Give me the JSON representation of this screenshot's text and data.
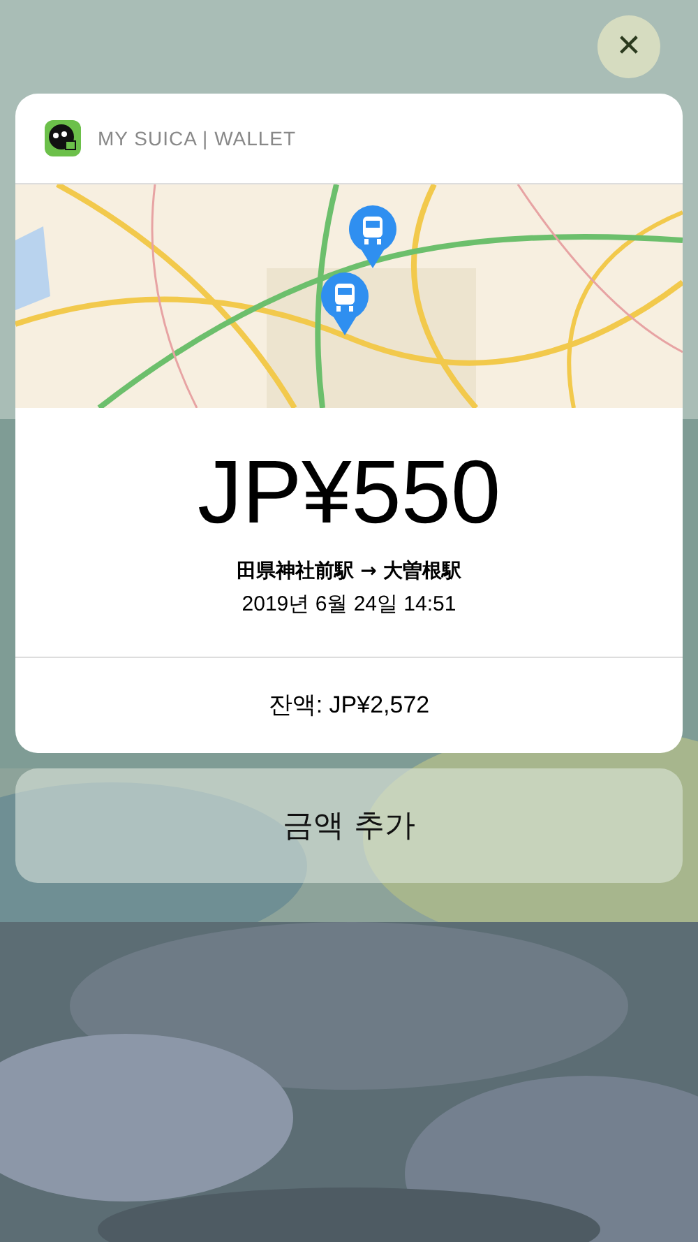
{
  "notification": {
    "app_name": "MY SUICA | WALLET",
    "map": {
      "kind": "picture",
      "pins": [
        {
          "kind": "train"
        },
        {
          "kind": "train"
        }
      ]
    },
    "amount": "JP¥550",
    "route": "田県神社前駅 → 大曽根駅",
    "datetime": "2019년 6월 24일 14:51",
    "balance": "잔액: JP¥2,572"
  },
  "action_button": "금액 추가",
  "close_button": "✕"
}
